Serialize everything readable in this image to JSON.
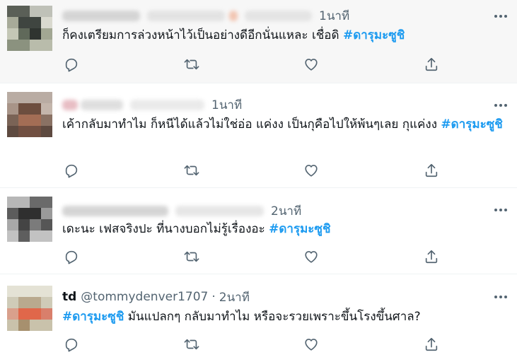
{
  "tweets": [
    {
      "name": "",
      "handle": "",
      "time": "1นาที",
      "text_before": "ก็คงเตรียมการล่วงหน้าไว้เป็นอย่างดีอีกนั่นแหละ เชื่อดิ ",
      "hashtag": "#ดารุมะซูชิ",
      "text_after": ""
    },
    {
      "name": "",
      "handle": "",
      "time": "1นาที",
      "text_before": "เค้ากลับมาทำไม ก็หนีได้แล้วไม่ใช่อ่อ แค่งง เป็นกุคือไปให้พ้นๆเลย กุแค่งง  ",
      "hashtag": "#ดารุมะซูชิ",
      "text_after": ""
    },
    {
      "name": "",
      "handle": "",
      "time": "2นาที",
      "text_before": "เดะนะ เฟสจริงปะ ที่นางบอกไม่รู้เรื่องอะ ",
      "hashtag": "#ดารุมะซูชิ",
      "text_after": ""
    },
    {
      "name": "td",
      "handle": "@tommydenver1707",
      "time": "2นาที",
      "text_before": "",
      "hashtag": "#ดารุมะซูชิ",
      "text_after": " มันแปลกๆ กลับมาทำไม หรือจะรวยเพราะขึ้นโรงขึ้นศาล?"
    }
  ],
  "icons": {
    "reply": "reply-icon",
    "retweet": "retweet-icon",
    "like": "like-icon",
    "share": "share-icon",
    "more": "more-icon"
  },
  "colors": {
    "hashtag": "#1d9bf0",
    "secondary_text": "#536471",
    "highlight_bg": "#f7f7f7"
  }
}
